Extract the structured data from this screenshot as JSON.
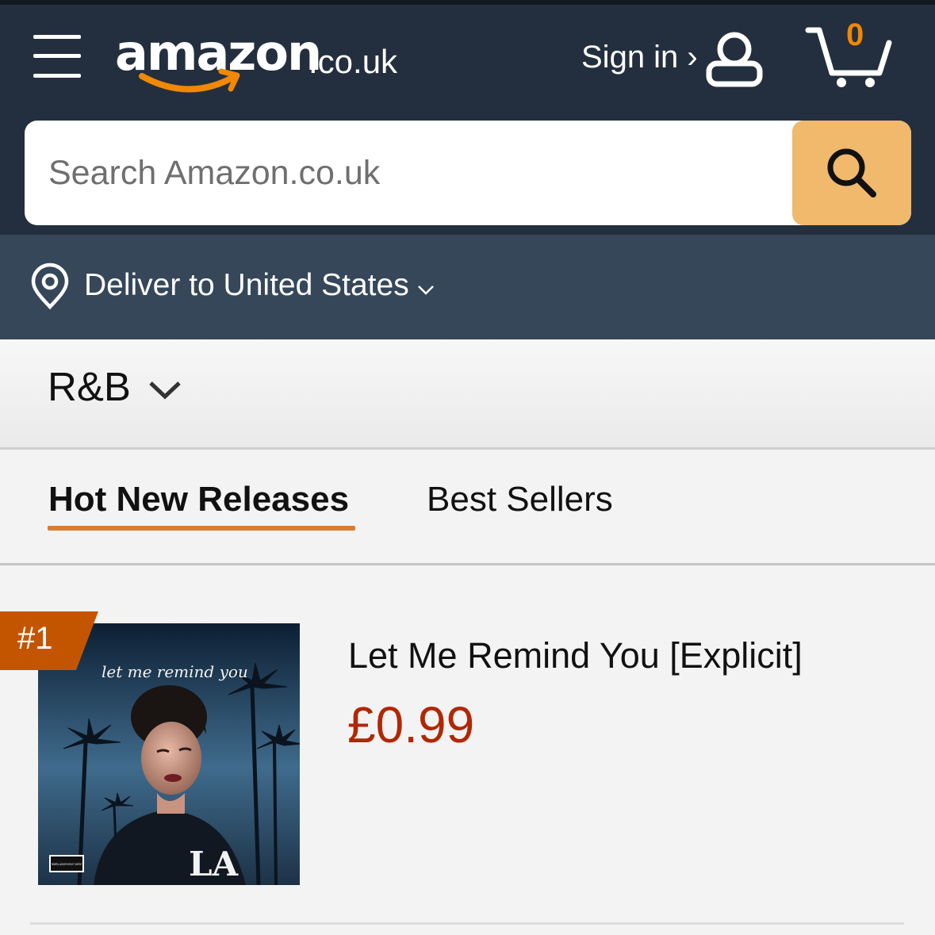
{
  "header": {
    "logo_text": "amazon",
    "logo_tld": ".co.uk",
    "sign_in_label": "Sign in ›",
    "cart_count": "0",
    "search_placeholder": "Search Amazon.co.uk"
  },
  "icons": {
    "menu": "hamburger-menu-icon",
    "user": "user-icon",
    "cart": "shopping-cart-icon",
    "search": "magnifier-icon",
    "location": "location-pin-icon",
    "chevron": "chevron-down-icon"
  },
  "delivery": {
    "label": "Deliver to United States"
  },
  "category": {
    "label": "R&B"
  },
  "tabs": [
    {
      "label": "Hot New Releases",
      "active": true
    },
    {
      "label": "Best Sellers",
      "active": false
    }
  ],
  "products": [
    {
      "rank": "#1",
      "cover_script": "let me remind you",
      "cover_logo": "LA",
      "advisory_label": "PARENTAL ADVISORY EXPLICIT CONTENT",
      "title": "Let Me Remind You [Explicit]",
      "price": "£0.99"
    }
  ],
  "colors": {
    "header_bg": "#232f3e",
    "delivery_bg": "#37475a",
    "search_button": "#f0b96b",
    "tab_underline": "#dd7b2f",
    "rank_badge": "#c45500",
    "price": "#b12704",
    "cart_count": "#f08804"
  }
}
